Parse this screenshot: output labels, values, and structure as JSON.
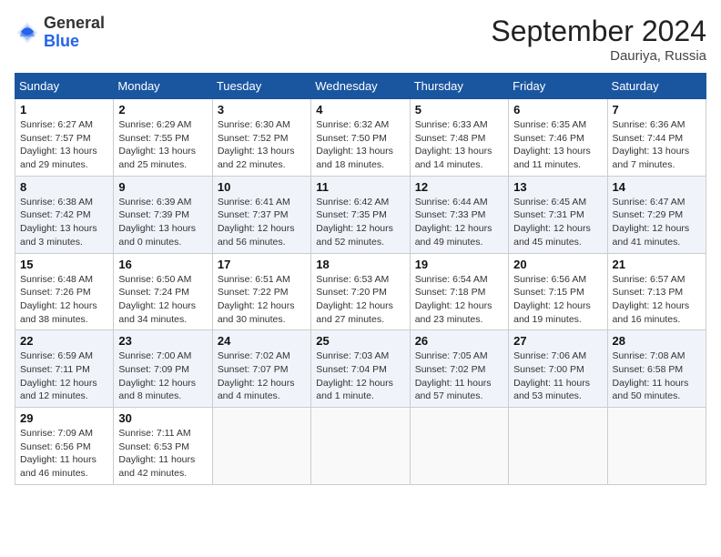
{
  "header": {
    "logo_line1": "General",
    "logo_line2": "Blue",
    "month": "September 2024",
    "location": "Dauriya, Russia"
  },
  "days_of_week": [
    "Sunday",
    "Monday",
    "Tuesday",
    "Wednesday",
    "Thursday",
    "Friday",
    "Saturday"
  ],
  "weeks": [
    [
      {
        "day": "1",
        "lines": [
          "Sunrise: 6:27 AM",
          "Sunset: 7:57 PM",
          "Daylight: 13 hours",
          "and 29 minutes."
        ]
      },
      {
        "day": "2",
        "lines": [
          "Sunrise: 6:29 AM",
          "Sunset: 7:55 PM",
          "Daylight: 13 hours",
          "and 25 minutes."
        ]
      },
      {
        "day": "3",
        "lines": [
          "Sunrise: 6:30 AM",
          "Sunset: 7:52 PM",
          "Daylight: 13 hours",
          "and 22 minutes."
        ]
      },
      {
        "day": "4",
        "lines": [
          "Sunrise: 6:32 AM",
          "Sunset: 7:50 PM",
          "Daylight: 13 hours",
          "and 18 minutes."
        ]
      },
      {
        "day": "5",
        "lines": [
          "Sunrise: 6:33 AM",
          "Sunset: 7:48 PM",
          "Daylight: 13 hours",
          "and 14 minutes."
        ]
      },
      {
        "day": "6",
        "lines": [
          "Sunrise: 6:35 AM",
          "Sunset: 7:46 PM",
          "Daylight: 13 hours",
          "and 11 minutes."
        ]
      },
      {
        "day": "7",
        "lines": [
          "Sunrise: 6:36 AM",
          "Sunset: 7:44 PM",
          "Daylight: 13 hours",
          "and 7 minutes."
        ]
      }
    ],
    [
      {
        "day": "8",
        "lines": [
          "Sunrise: 6:38 AM",
          "Sunset: 7:42 PM",
          "Daylight: 13 hours",
          "and 3 minutes."
        ]
      },
      {
        "day": "9",
        "lines": [
          "Sunrise: 6:39 AM",
          "Sunset: 7:39 PM",
          "Daylight: 13 hours",
          "and 0 minutes."
        ]
      },
      {
        "day": "10",
        "lines": [
          "Sunrise: 6:41 AM",
          "Sunset: 7:37 PM",
          "Daylight: 12 hours",
          "and 56 minutes."
        ]
      },
      {
        "day": "11",
        "lines": [
          "Sunrise: 6:42 AM",
          "Sunset: 7:35 PM",
          "Daylight: 12 hours",
          "and 52 minutes."
        ]
      },
      {
        "day": "12",
        "lines": [
          "Sunrise: 6:44 AM",
          "Sunset: 7:33 PM",
          "Daylight: 12 hours",
          "and 49 minutes."
        ]
      },
      {
        "day": "13",
        "lines": [
          "Sunrise: 6:45 AM",
          "Sunset: 7:31 PM",
          "Daylight: 12 hours",
          "and 45 minutes."
        ]
      },
      {
        "day": "14",
        "lines": [
          "Sunrise: 6:47 AM",
          "Sunset: 7:29 PM",
          "Daylight: 12 hours",
          "and 41 minutes."
        ]
      }
    ],
    [
      {
        "day": "15",
        "lines": [
          "Sunrise: 6:48 AM",
          "Sunset: 7:26 PM",
          "Daylight: 12 hours",
          "and 38 minutes."
        ]
      },
      {
        "day": "16",
        "lines": [
          "Sunrise: 6:50 AM",
          "Sunset: 7:24 PM",
          "Daylight: 12 hours",
          "and 34 minutes."
        ]
      },
      {
        "day": "17",
        "lines": [
          "Sunrise: 6:51 AM",
          "Sunset: 7:22 PM",
          "Daylight: 12 hours",
          "and 30 minutes."
        ]
      },
      {
        "day": "18",
        "lines": [
          "Sunrise: 6:53 AM",
          "Sunset: 7:20 PM",
          "Daylight: 12 hours",
          "and 27 minutes."
        ]
      },
      {
        "day": "19",
        "lines": [
          "Sunrise: 6:54 AM",
          "Sunset: 7:18 PM",
          "Daylight: 12 hours",
          "and 23 minutes."
        ]
      },
      {
        "day": "20",
        "lines": [
          "Sunrise: 6:56 AM",
          "Sunset: 7:15 PM",
          "Daylight: 12 hours",
          "and 19 minutes."
        ]
      },
      {
        "day": "21",
        "lines": [
          "Sunrise: 6:57 AM",
          "Sunset: 7:13 PM",
          "Daylight: 12 hours",
          "and 16 minutes."
        ]
      }
    ],
    [
      {
        "day": "22",
        "lines": [
          "Sunrise: 6:59 AM",
          "Sunset: 7:11 PM",
          "Daylight: 12 hours",
          "and 12 minutes."
        ]
      },
      {
        "day": "23",
        "lines": [
          "Sunrise: 7:00 AM",
          "Sunset: 7:09 PM",
          "Daylight: 12 hours",
          "and 8 minutes."
        ]
      },
      {
        "day": "24",
        "lines": [
          "Sunrise: 7:02 AM",
          "Sunset: 7:07 PM",
          "Daylight: 12 hours",
          "and 4 minutes."
        ]
      },
      {
        "day": "25",
        "lines": [
          "Sunrise: 7:03 AM",
          "Sunset: 7:04 PM",
          "Daylight: 12 hours",
          "and 1 minute."
        ]
      },
      {
        "day": "26",
        "lines": [
          "Sunrise: 7:05 AM",
          "Sunset: 7:02 PM",
          "Daylight: 11 hours",
          "and 57 minutes."
        ]
      },
      {
        "day": "27",
        "lines": [
          "Sunrise: 7:06 AM",
          "Sunset: 7:00 PM",
          "Daylight: 11 hours",
          "and 53 minutes."
        ]
      },
      {
        "day": "28",
        "lines": [
          "Sunrise: 7:08 AM",
          "Sunset: 6:58 PM",
          "Daylight: 11 hours",
          "and 50 minutes."
        ]
      }
    ],
    [
      {
        "day": "29",
        "lines": [
          "Sunrise: 7:09 AM",
          "Sunset: 6:56 PM",
          "Daylight: 11 hours",
          "and 46 minutes."
        ]
      },
      {
        "day": "30",
        "lines": [
          "Sunrise: 7:11 AM",
          "Sunset: 6:53 PM",
          "Daylight: 11 hours",
          "and 42 minutes."
        ]
      },
      {
        "day": "",
        "lines": []
      },
      {
        "day": "",
        "lines": []
      },
      {
        "day": "",
        "lines": []
      },
      {
        "day": "",
        "lines": []
      },
      {
        "day": "",
        "lines": []
      }
    ]
  ]
}
